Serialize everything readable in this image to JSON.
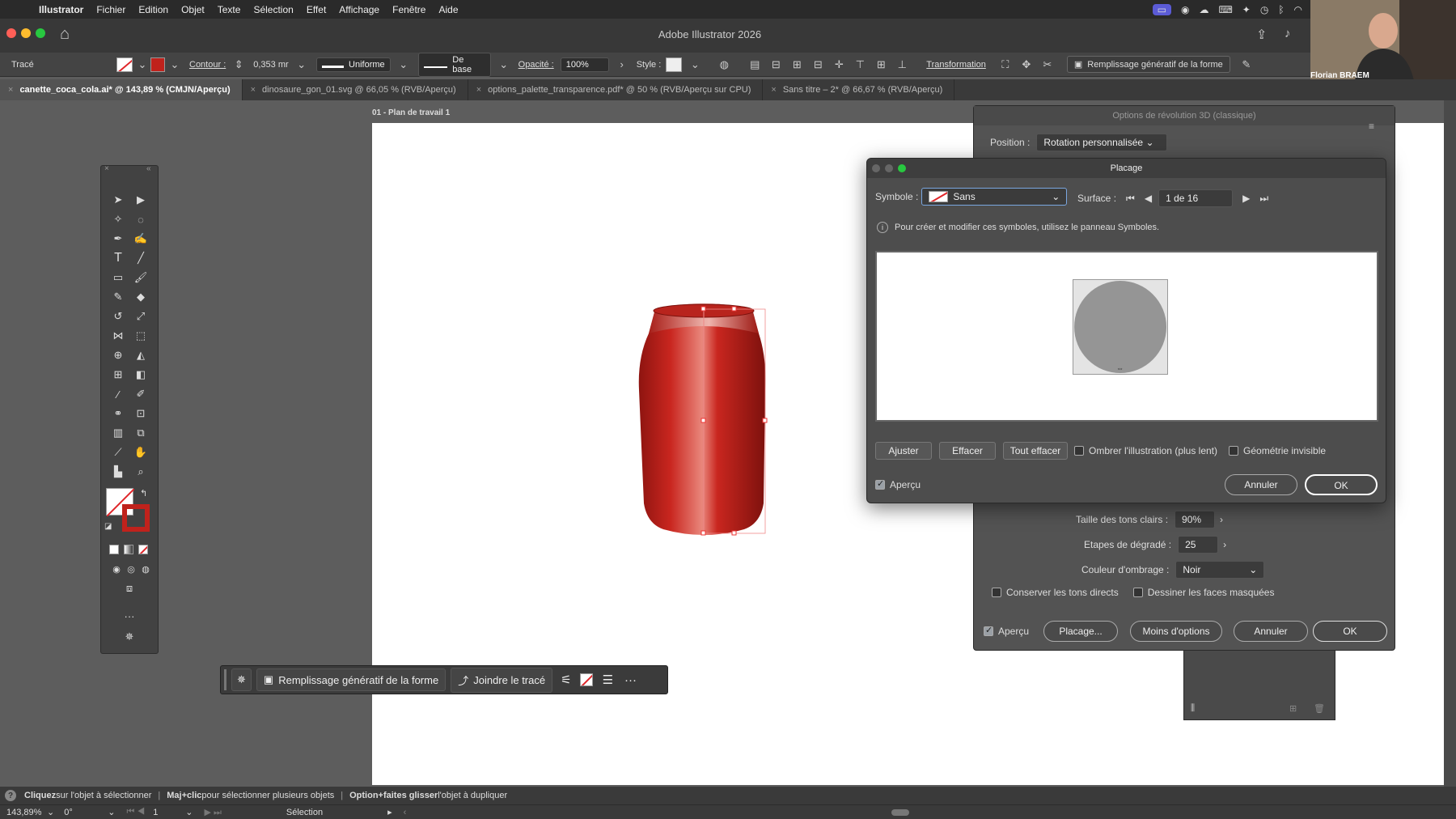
{
  "menubar": {
    "app": "Illustrator",
    "items": [
      "Fichier",
      "Edition",
      "Objet",
      "Texte",
      "Sélection",
      "Effet",
      "Affichage",
      "Fenêtre",
      "Aide"
    ]
  },
  "window": {
    "title": "Adobe Illustrator 2026"
  },
  "control_bar": {
    "object_type": "Tracé",
    "contour_label": "Contour :",
    "contour_value": "0,353 mr",
    "profile": "Uniforme",
    "brush": "De base",
    "opacity_label": "Opacité :",
    "opacity_value": "100%",
    "style_label": "Style :",
    "transform_label": "Transformation",
    "gen_fill_label": "Remplissage génératif de la forme"
  },
  "tabs": [
    {
      "label": "canette_coca_cola.ai* @ 143,89 % (CMJN/Aperçu)",
      "active": true
    },
    {
      "label": "dinosaure_gon_01.svg @ 66,05 % (RVB/Aperçu)",
      "active": false
    },
    {
      "label": "options_palette_transparence.pdf* @ 50 % (RVB/Aperçu sur CPU)",
      "active": false
    },
    {
      "label": "Sans titre – 2* @ 66,67 % (RVB/Aperçu)",
      "active": false
    }
  ],
  "artboard": {
    "label": "01 - Plan de travail 1"
  },
  "context_bar": {
    "gen_fill": "Remplissage génératif de la forme",
    "join_path": "Joindre le tracé"
  },
  "revolve_panel": {
    "title": "Options de révolution 3D (classique)",
    "position_label": "Position :",
    "position_value": "Rotation personnalisée",
    "highlight_label": "Taille des tons clairs :",
    "highlight_value": "90%",
    "steps_label": "Etapes de dégradé :",
    "steps_value": "25",
    "shade_label": "Couleur d'ombrage :",
    "shade_value": "Noir",
    "keep_spot": "Conserver les tons directs",
    "draw_hidden": "Dessiner les faces masquées",
    "preview": "Aperçu",
    "map_btn": "Placage...",
    "fewer_btn": "Moins d'options",
    "cancel_btn": "Annuler",
    "ok_btn": "OK"
  },
  "placage_dialog": {
    "title": "Placage",
    "symbol_label": "Symbole :",
    "symbol_value": "Sans",
    "surface_label": "Surface :",
    "surface_value": "1 de 16",
    "info": "Pour créer et modifier ces symboles, utilisez le panneau Symboles.",
    "btn_fit": "Ajuster",
    "btn_clear": "Effacer",
    "btn_clear_all": "Tout effacer",
    "shade_art": "Ombrer l'illustration (plus lent)",
    "invisible_geo": "Géométrie invisible",
    "preview": "Aperçu",
    "cancel": "Annuler",
    "ok": "OK"
  },
  "status_help": {
    "part1_bold": "Cliquez",
    "part1": " sur l'objet à sélectionner",
    "part2_bold": "Maj+clic",
    "part2": " pour sélectionner plusieurs objets",
    "part3_bold": "Option+faites glisser",
    "part3": " l'objet à dupliquer"
  },
  "status_bar": {
    "zoom": "143,89%",
    "rotation": "0°",
    "artboard_num": "1",
    "tool": "Sélection"
  },
  "webcam": {
    "name": "Florian BRAEM"
  },
  "colors": {
    "can_red": "#c0221c",
    "accent": "#5b5bd6"
  }
}
